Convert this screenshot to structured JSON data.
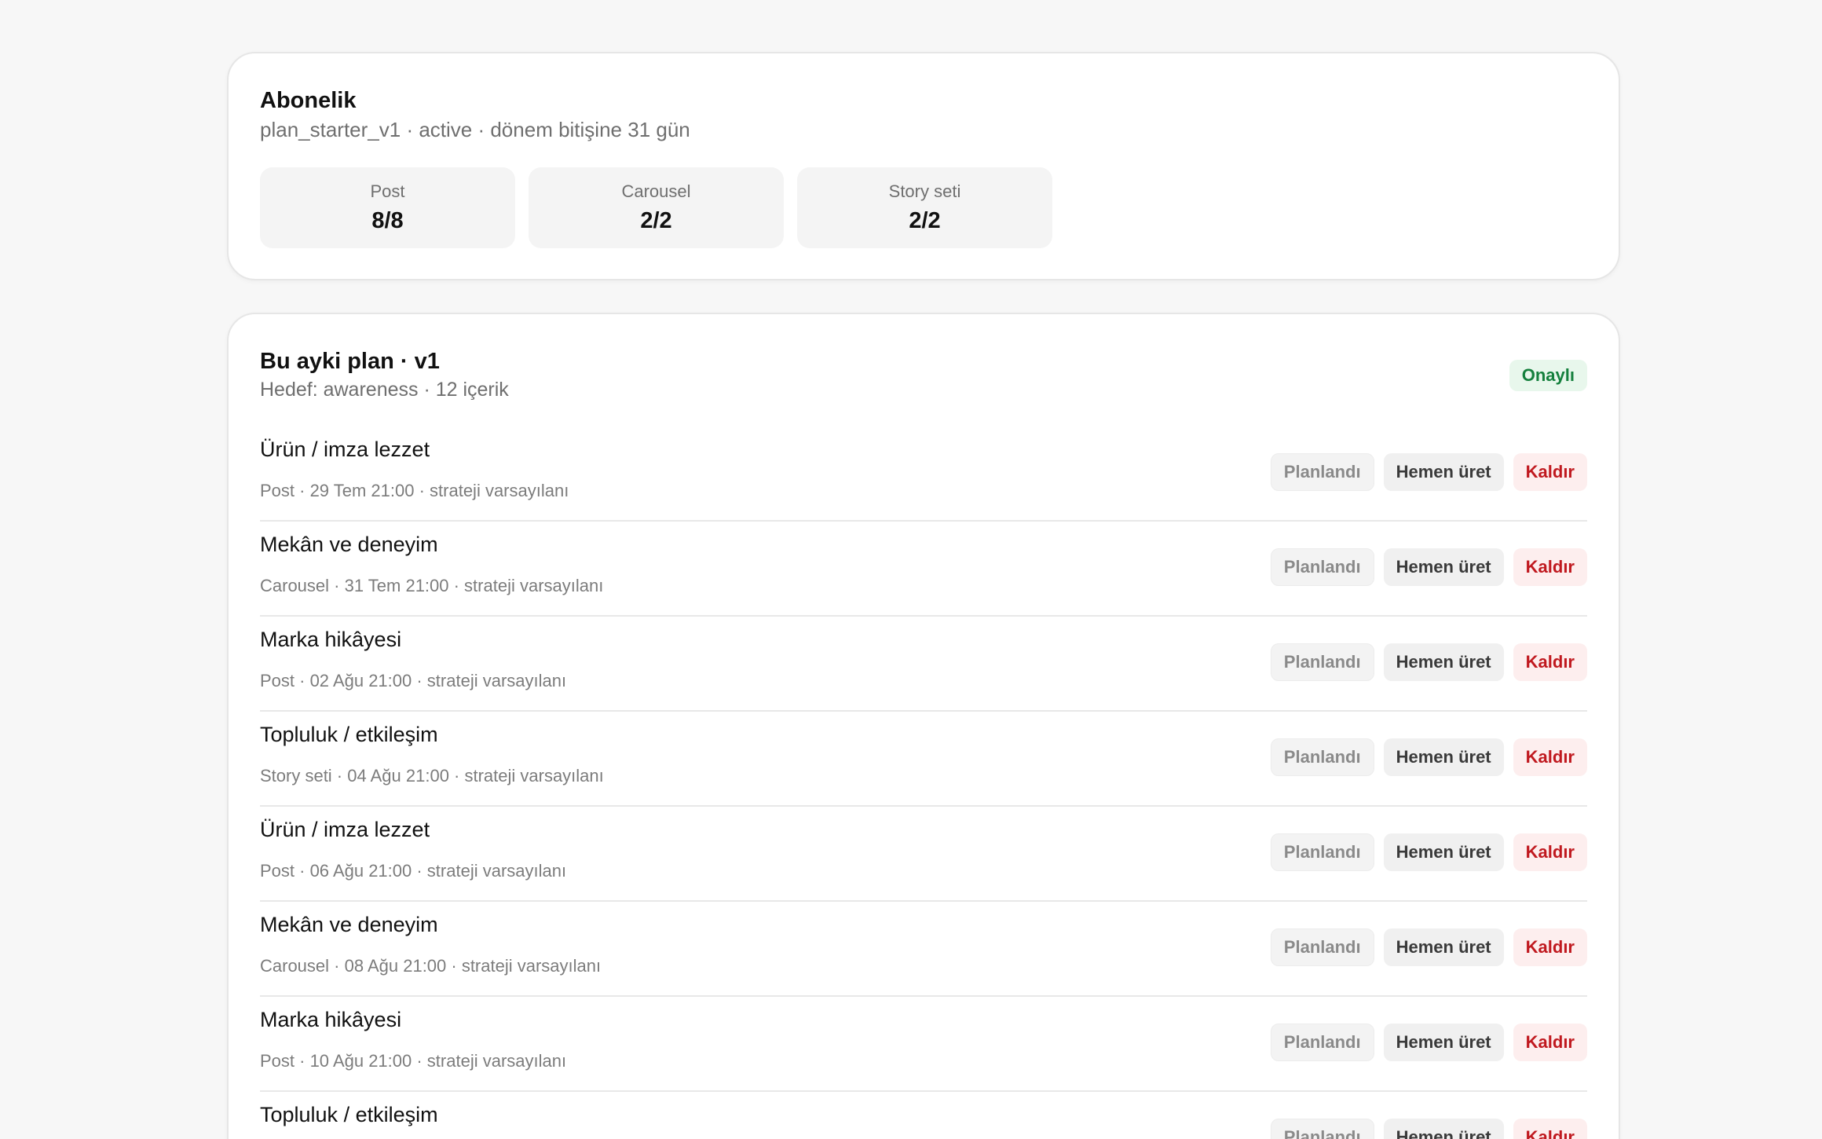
{
  "subscription": {
    "title": "Abonelik",
    "meta": "plan_starter_v1 · active · dönem bitişine 31 gün",
    "stats": [
      {
        "label": "Post",
        "value": "8/8"
      },
      {
        "label": "Carousel",
        "value": "2/2"
      },
      {
        "label": "Story seti",
        "value": "2/2"
      }
    ]
  },
  "plan": {
    "title": "Bu ayki plan · v1",
    "meta": "Hedef: awareness · 12 içerik",
    "status_badge": "Onaylı",
    "actions": {
      "status_label": "Planlandı",
      "produce_label": "Hemen üret",
      "remove_label": "Kaldır"
    },
    "items": [
      {
        "title": "Ürün / imza lezzet",
        "meta": "Post · 29 Tem 21:00 · strateji varsayılanı"
      },
      {
        "title": "Mekân ve deneyim",
        "meta": "Carousel · 31 Tem 21:00 · strateji varsayılanı"
      },
      {
        "title": "Marka hikâyesi",
        "meta": "Post · 02 Ağu 21:00 · strateji varsayılanı"
      },
      {
        "title": "Topluluk / etkileşim",
        "meta": "Story seti · 04 Ağu 21:00 · strateji varsayılanı"
      },
      {
        "title": "Ürün / imza lezzet",
        "meta": "Post · 06 Ağu 21:00 · strateji varsayılanı"
      },
      {
        "title": "Mekân ve deneyim",
        "meta": "Carousel · 08 Ağu 21:00 · strateji varsayılanı"
      },
      {
        "title": "Marka hikâyesi",
        "meta": "Post · 10 Ağu 21:00 · strateji varsayılanı"
      },
      {
        "title": "Topluluk / etkileşim",
        "meta": ""
      }
    ]
  }
}
